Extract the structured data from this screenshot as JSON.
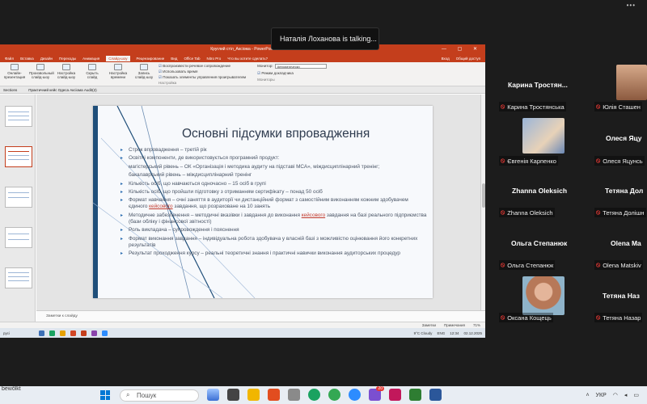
{
  "speaking_popup": "Наталія Лоханова is talking...",
  "menu_dots": "•••",
  "ppt": {
    "window_title": "Круглий стіл_Аксіома - PowerPoint",
    "window_controls": "— ▢ ✕",
    "tabs": [
      "Файл",
      "Вставка",
      "Дизайн",
      "Переходы",
      "Анимация",
      "Слайд-шоу",
      "Рецензирование",
      "Вид",
      "Office Tab",
      "Nitro Pro",
      "Что вы хотите сделать?"
    ],
    "active_tab": "Слайд-шоу",
    "account": "Вход",
    "share": "Общий доступ",
    "ribbon_buttons": [
      "Онлайн-презентация",
      "Произвольный слайд-шоу",
      "Настройка слайд-шоу",
      "Скрыть слайд",
      "Настройка времени",
      "Запись слайд-шоу"
    ],
    "ribbon_checks": [
      "Воспроизвести речевое сопровождение",
      "Использовать время",
      "Показать элементы управления проигрывателем"
    ],
    "ribbon_group": "Настройка",
    "monitor_label": "Монитор:",
    "monitor_value": "Автоматически",
    "presenter_mode": "Режим докладчика",
    "monitors_group": "Мониторы",
    "doc_tab_sections": "Sections",
    "doc_tab": "Практичний кейс Одеса Аксіома Audit(2)",
    "notes_placeholder": "Заметки к слайду",
    "status": [
      "Заметки",
      "Примечания"
    ],
    "zoom": "71%"
  },
  "slide": {
    "title": "Основні підсумки впровадження",
    "items": [
      {
        "text": "Строк впровадження – третій рік",
        "bullet": true
      },
      {
        "text": "Освітні компоненти, де використовується програмний продукт:",
        "bullet": true
      },
      {
        "text": "магістерський рівень – ОК «Організація і методика аудиту на підставі МСА», міждисциплінарний тренінг;",
        "bullet": false
      },
      {
        "text": "бакалаврський рівень – міждисциплінарний тренінг",
        "bullet": false
      },
      {
        "text": "Кількість осіб, що навчаються одночасно – 15 осіб в групі",
        "bullet": true
      },
      {
        "text": "Кількість осіб, що пройшли підготовку з отриманням сертифікату – понад 50 осіб",
        "bullet": true
      },
      {
        "text_before": "Формат навчання – очні заняття в аудиторії чи дистанційний формат з самостійним виконанням кожним здобувачем єдиного ",
        "link": "кейсового",
        "text_after": " завдання, що розраховане на 10 занять",
        "bullet": true
      },
      {
        "text_before": "Методичне забезпечення – методичні вказівки і завдання до виконання ",
        "link": "кейсового",
        "text_after": " завдання на базі реального підприємства (бази обліку і фінансової звітності)",
        "bullet": true
      },
      {
        "text": "Роль викладача – супровождення і пояснення",
        "bullet": true
      },
      {
        "text": "Формат виконання завдання – індивідуальна робота здобувача у власній базі з можливістю оцінювання його конкретних результатів",
        "bullet": true
      },
      {
        "text": "Результат проходження курсу – реальні теоретичні знання і практичні навички виконання аудиторських процедур",
        "bullet": true
      }
    ]
  },
  "inner_taskbar": {
    "left": "русі",
    "weather": "9°C Cloudy",
    "lang": "ENG",
    "time": "12:34",
    "date": "02.12.2025"
  },
  "participants": [
    {
      "name": "Карина Тростян...",
      "label": "Карина Тростянська",
      "photo": false
    },
    {
      "name": "",
      "label": "Юлія Сташен",
      "photo": true,
      "photo_color": "#c58f6a"
    },
    {
      "name": "",
      "label": "Євгенія Карпенко",
      "photo": true,
      "photo_color": "#6a88b6"
    },
    {
      "name": "Олеся Яцу",
      "label": "Олеся Яцунсь",
      "photo": false
    },
    {
      "name": "Zhanna Oleksich",
      "label": "Zhanna Oleksich",
      "photo": false
    },
    {
      "name": "Тетяна Дол",
      "label": "Тетяна Долішн",
      "photo": false
    },
    {
      "name": "Ольга Степанюк",
      "label": "Ольга Степанюк",
      "photo": false
    },
    {
      "name": "Olena Ma",
      "label": "Olena Matskiv",
      "photo": false
    },
    {
      "name": "",
      "label": "Оксана Кощець",
      "photo": true,
      "photo_color": "#b77858"
    },
    {
      "name": "Тетяна Наз",
      "label": "Тетяна Назар",
      "photo": false
    }
  ],
  "taskbar": {
    "left_text": "bewölkt",
    "search": "Пошук",
    "lang": "УКР",
    "badge": "20"
  },
  "colors": {
    "ppt_accent": "#c43e1c",
    "slide_bar": "#1f4e79",
    "mic_off": "#e53935"
  }
}
